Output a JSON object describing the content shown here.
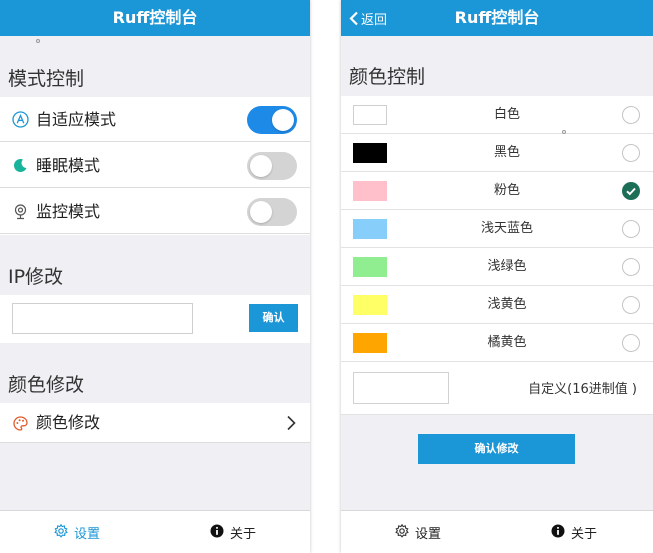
{
  "left": {
    "header": {
      "title": "Ruff控制台"
    },
    "mode_section": {
      "title": "模式控制",
      "items": [
        {
          "label": "自适应模式",
          "icon": "auto-mode-icon",
          "state": "on"
        },
        {
          "label": "睡眠模式",
          "icon": "moon-icon",
          "state": "off"
        },
        {
          "label": "监控模式",
          "icon": "webcam-icon",
          "state": "off"
        }
      ]
    },
    "ip_section": {
      "title": "IP修改",
      "input_value": "",
      "confirm_label": "确认"
    },
    "color_section": {
      "title": "颜色修改",
      "item_label": "颜色修改"
    },
    "tabbar": {
      "settings_label": "设置",
      "about_label": "关于",
      "active": "settings"
    }
  },
  "right": {
    "header": {
      "title": "Ruff控制台",
      "back_label": "返回"
    },
    "section_title": "颜色控制",
    "colors": [
      {
        "name": "白色",
        "swatch": "#ffffff",
        "selected": false
      },
      {
        "name": "黑色",
        "swatch": "#000000",
        "selected": false
      },
      {
        "name": "粉色",
        "swatch": "#ffc0cb",
        "selected": true
      },
      {
        "name": "浅天蓝色",
        "swatch": "#87cefa",
        "selected": false
      },
      {
        "name": "浅绿色",
        "swatch": "#90ee90",
        "selected": false
      },
      {
        "name": "浅黄色",
        "swatch": "#ffff66",
        "selected": false
      },
      {
        "name": "橘黄色",
        "swatch": "#ffa500",
        "selected": false
      }
    ],
    "custom": {
      "input_value": "",
      "label": "自定义(16进制值 )"
    },
    "confirm_label": "确认修改",
    "tabbar": {
      "settings_label": "设置",
      "about_label": "关于"
    }
  },
  "theme": {
    "accent": "#1b96d6",
    "toggle_on": "#1e8ae8",
    "toggle_off": "#d4d4d4",
    "check": "#1d6e57",
    "active_tab": "#1b96d6"
  }
}
